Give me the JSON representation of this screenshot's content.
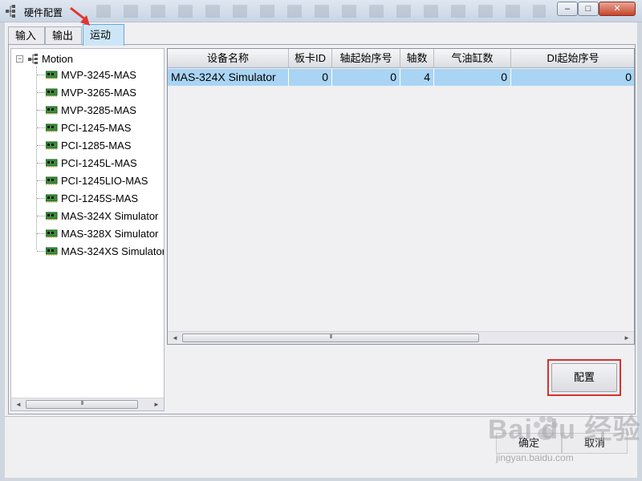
{
  "window": {
    "title": "硬件配置",
    "buttons": {
      "minimize": "–",
      "maximize": "□",
      "close": "✕"
    }
  },
  "tabs": [
    {
      "label": "输入"
    },
    {
      "label": "输出"
    },
    {
      "label": "运动",
      "selected": true
    }
  ],
  "tree": {
    "root": "Motion",
    "expander": "−",
    "items": [
      "MVP-3245-MAS",
      "MVP-3265-MAS",
      "MVP-3285-MAS",
      "PCI-1245-MAS",
      "PCI-1285-MAS",
      "PCI-1245L-MAS",
      "PCI-1245LIO-MAS",
      "PCI-1245S-MAS",
      "MAS-324X Simulator",
      "MAS-328X Simulator",
      "MAS-324XS Simulator"
    ]
  },
  "grid": {
    "columns": [
      "设备名称",
      "板卡ID",
      "轴起始序号",
      "轴数",
      "气油缸数",
      "DI起始序号"
    ],
    "rows": [
      [
        "MAS-324X Simulator",
        "0",
        "0",
        "4",
        "0",
        "0"
      ]
    ]
  },
  "scroll": {
    "left_arrow": "◄",
    "right_arrow": "►",
    "grip": "III"
  },
  "buttons": {
    "config": "配置",
    "ok": "确定",
    "cancel": "取消"
  },
  "watermark": {
    "logo": "Bai du 经验",
    "url": "jingyan.baidu.com"
  },
  "colors": {
    "selected_tab": "#cde6f7",
    "selected_row": "#a9d4f4",
    "highlight_box": "#d6312c"
  }
}
